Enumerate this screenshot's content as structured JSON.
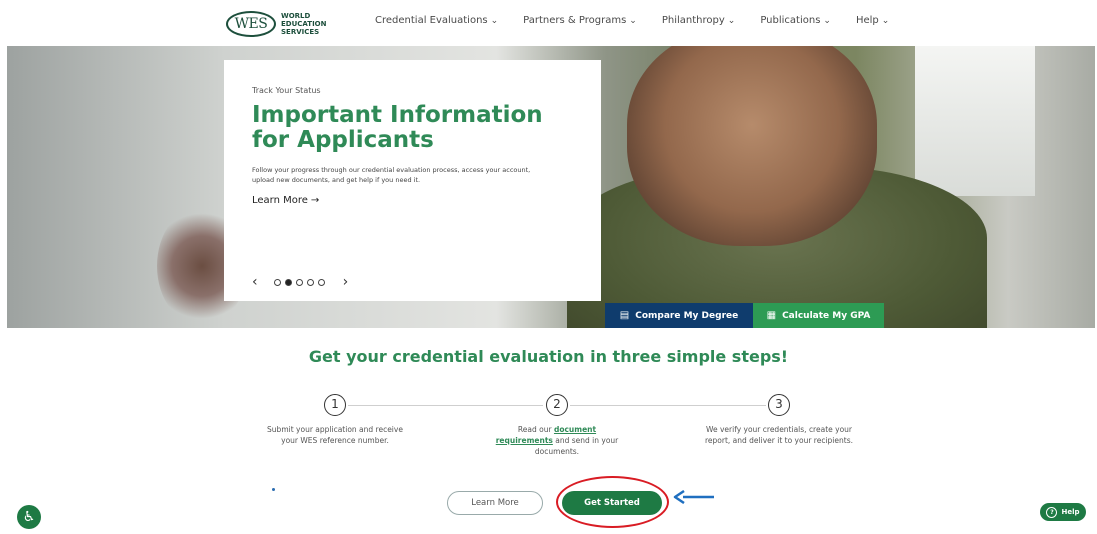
{
  "logo": {
    "mark": "WES",
    "line1": "WORLD",
    "line2": "EDUCATION",
    "line3": "SERVICES"
  },
  "nav": [
    {
      "label": "Credential Evaluations",
      "icon": "chevron-down-icon"
    },
    {
      "label": "Partners & Programs",
      "icon": "chevron-down-icon"
    },
    {
      "label": "Philanthropy",
      "icon": "chevron-down-icon"
    },
    {
      "label": "Publications",
      "icon": "chevron-down-icon"
    },
    {
      "label": "Help",
      "icon": "chevron-down-icon"
    }
  ],
  "hero": {
    "eyebrow": "Track Your Status",
    "title": "Important Information for Applicants",
    "description": "Follow your progress through our credential evaluation process, access your account, upload new documents, and get help if you need it.",
    "learn_more": "Learn More",
    "arrow": "→",
    "carousel": {
      "prev": "‹",
      "next": "›",
      "total": 5,
      "active": 2
    }
  },
  "tools": {
    "compare": "Compare My Degree",
    "gpa": "Calculate My GPA"
  },
  "steps": {
    "heading": "Get your credential evaluation in three simple steps!",
    "items": [
      {
        "number": "1",
        "text": "Submit your application and receive your WES reference number."
      },
      {
        "number": "2",
        "text_before": "Read our ",
        "link1": "document",
        "link2": "requirements",
        "text_after": " and send in your documents."
      },
      {
        "number": "3",
        "text": "We verify your credentials, create your report, and deliver it to your recipients."
      }
    ]
  },
  "actions": {
    "learn_more": "Learn More",
    "get_started": "Get Started"
  },
  "help": {
    "label": "Help",
    "icon": "question-icon"
  },
  "accessibility": {
    "icon": "accessibility-icon"
  },
  "colors": {
    "brand_green": "#2f8a57",
    "dark_green": "#1e7a44",
    "navy": "#0f3c6d",
    "highlight_red": "#d91c24",
    "arrow_blue": "#1f6fc0"
  }
}
